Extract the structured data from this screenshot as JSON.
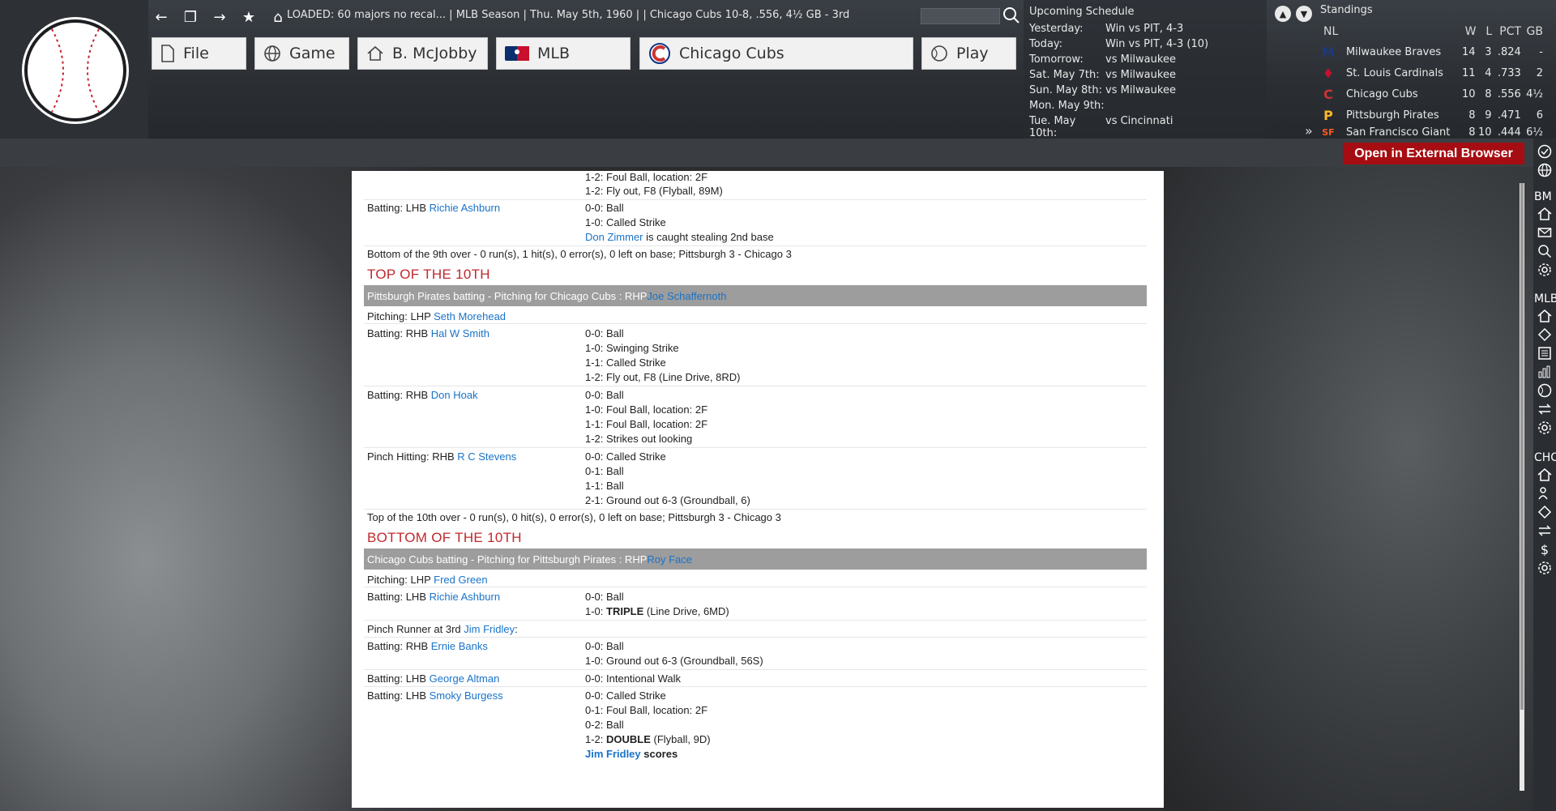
{
  "nav": {
    "status": "LOADED: 60 majors no recal...  |  MLB Season  |  Thu. May 5th, 1960  |    |  Chicago Cubs  10-8, .556, 4½ GB - 3rd"
  },
  "menu": {
    "file": "File",
    "game": "Game",
    "manager": "B. McJobby",
    "league": "MLB",
    "team": "Chicago Cubs",
    "play": "Play"
  },
  "schedule": {
    "title": "Upcoming Schedule",
    "rows": [
      {
        "day": "Yesterday:",
        "info": "Win vs PIT, 4-3"
      },
      {
        "day": "Today:",
        "info": "Win vs PIT, 4-3 (10)"
      },
      {
        "day": "Tomorrow:",
        "info": "vs Milwaukee"
      },
      {
        "day": "Sat. May 7th:",
        "info": "vs Milwaukee"
      },
      {
        "day": "Sun. May 8th:",
        "info": "vs Milwaukee"
      },
      {
        "day": "Mon. May 9th:",
        "info": ""
      },
      {
        "day": "Tue. May 10th:",
        "info": "vs Cincinnati"
      }
    ]
  },
  "standings": {
    "title": "Standings",
    "league": "NL",
    "cols": {
      "w": "W",
      "l": "L",
      "pct": "PCT",
      "gb": "GB"
    },
    "rows": [
      {
        "team": "Milwaukee Braves",
        "w": "14",
        "l": "3",
        "pct": ".824",
        "gb": "-",
        "mark": "M",
        "color": "#1f3a7a"
      },
      {
        "team": "St. Louis Cardinals",
        "w": "11",
        "l": "4",
        "pct": ".733",
        "gb": "2",
        "mark": "♦",
        "color": "#c8102e"
      },
      {
        "team": "Chicago Cubs",
        "w": "10",
        "l": "8",
        "pct": ".556",
        "gb": "4½",
        "mark": "C",
        "color": "#cc3433"
      },
      {
        "team": "Pittsburgh Pirates",
        "w": "8",
        "l": "9",
        "pct": ".471",
        "gb": "6",
        "mark": "P",
        "color": "#fdb827"
      },
      {
        "team": "San Francisco Giant",
        "w": "8",
        "l": "10",
        "pct": ".444",
        "gb": "6½",
        "mark": "SF",
        "color": "#fd5a1e"
      }
    ]
  },
  "external_button": "Open in External Browser",
  "sidebar": {
    "bm": "BM",
    "mlb": "MLB",
    "chc": "CHC"
  },
  "log": {
    "l1": "1-2: Foul Ball, location: 2F",
    "l2": "1-2: Fly out, F8 (Flyball, 89M)",
    "b1_pre": "Batting: LHB ",
    "b1_name": "Richie Ashburn",
    "b1_e1": "0-0: Ball",
    "b1_e2": "1-0: Called Strike",
    "b1_e3_name": "Don Zimmer",
    "b1_e3": " is caught stealing 2nd base",
    "sum9": "Bottom of the 9th over - 0 run(s), 1 hit(s), 0 error(s), 0 left on base; Pittsburgh 3 - Chicago 3",
    "hd_top10": "TOP OF THE 10TH",
    "gray1": "Pittsburgh Pirates batting - Pitching for Chicago Cubs : RHP ",
    "gray1_name": "Joe Schaffernoth",
    "p1_pre": "Pitching: LHP ",
    "p1_name": "Seth Morehead",
    "b2_pre": "Batting: RHB ",
    "b2_name": "Hal W Smith",
    "b2_e": [
      "0-0: Ball",
      "1-0: Swinging Strike",
      "1-1: Called Strike",
      "1-2: Fly out, F8 (Line Drive, 8RD)"
    ],
    "b3_pre": "Batting: RHB ",
    "b3_name": "Don Hoak",
    "b3_e": [
      "0-0: Ball",
      "1-0: Foul Ball, location: 2F",
      "1-1: Foul Ball, location: 2F",
      "1-2: Strikes out looking"
    ],
    "b4_pre": "Pinch Hitting: RHB ",
    "b4_name": "R C Stevens",
    "b4_e": [
      "0-0: Called Strike",
      "0-1: Ball",
      "1-1: Ball",
      "2-1: Ground out 6-3 (Groundball, 6)"
    ],
    "sum10t": "Top of the 10th over - 0 run(s), 0 hit(s), 0 error(s), 0 left on base; Pittsburgh 3 - Chicago 3",
    "hd_bot10": "BOTTOM OF THE 10TH",
    "gray2": "Chicago Cubs batting - Pitching for Pittsburgh Pirates : RHP ",
    "gray2_name": "Roy Face",
    "p2_pre": "Pitching: LHP ",
    "p2_name": "Fred Green",
    "b5_pre": "Batting: LHB ",
    "b5_name": "Richie Ashburn",
    "b5_e1": "0-0: Ball",
    "b5_e2_pre": "1-0: ",
    "b5_e2_bold": "TRIPLE",
    "b5_e2_post": " (Line Drive, 6MD)",
    "pr_pre": "Pinch Runner at 3rd ",
    "pr_name": "Jim Fridley",
    "pr_post": ":",
    "b6_pre": "Batting: RHB ",
    "b6_name": "Ernie Banks",
    "b6_e": [
      "0-0: Ball",
      "1-0: Ground out 6-3 (Groundball, 56S)"
    ],
    "b7_pre": "Batting: LHB ",
    "b7_name": "George Altman",
    "b7_e": "0-0: Intentional Walk",
    "b8_pre": "Batting: LHB ",
    "b8_name": "Smoky Burgess",
    "b8_e": [
      "0-0: Called Strike",
      "0-1: Foul Ball, location: 2F",
      "0-2: Ball"
    ],
    "b8_e4_pre": "1-2: ",
    "b8_e4_bold": "DOUBLE",
    "b8_e4_post": " (Flyball, 9D)",
    "b8_e5_name": "Jim Fridley",
    "b8_e5_post": " scores"
  }
}
